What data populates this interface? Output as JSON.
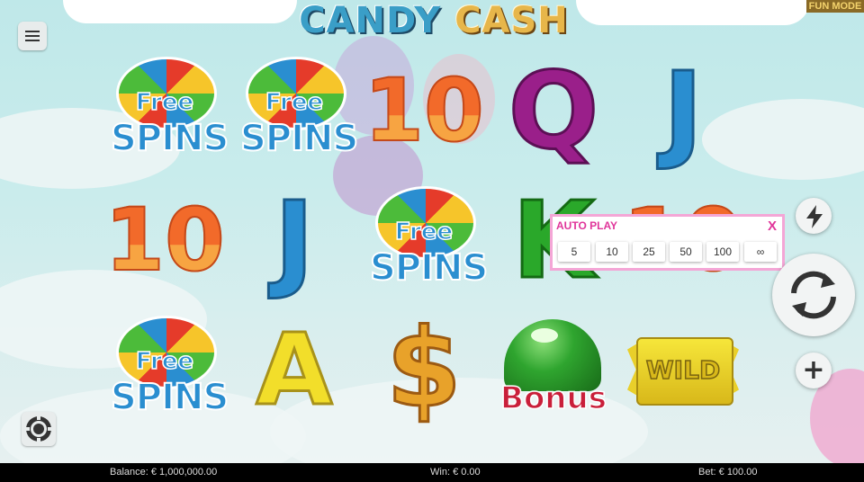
{
  "game": {
    "title_part1": "CANDY",
    "title_part2": "CASH",
    "mode_badge": "FUN MODE"
  },
  "menu": {
    "icon": "hamburger-menu-icon"
  },
  "reels": {
    "rows": [
      [
        {
          "type": "free-spins",
          "line1": "Free",
          "line2": "SPINS"
        },
        {
          "type": "free-spins",
          "line1": "Free",
          "line2": "SPINS"
        },
        {
          "type": "ten",
          "text": "10"
        },
        {
          "type": "q",
          "text": "Q"
        },
        {
          "type": "j",
          "text": "J"
        }
      ],
      [
        {
          "type": "ten",
          "text": "10"
        },
        {
          "type": "j",
          "text": "J"
        },
        {
          "type": "free-spins",
          "line1": "Free",
          "line2": "SPINS"
        },
        {
          "type": "k",
          "text": "K"
        },
        {
          "type": "ten",
          "text": "10"
        }
      ],
      [
        {
          "type": "free-spins",
          "line1": "Free",
          "line2": "SPINS"
        },
        {
          "type": "a",
          "text": "A"
        },
        {
          "type": "dollar",
          "text": "$"
        },
        {
          "type": "bonus",
          "text": "Bonus"
        },
        {
          "type": "wild",
          "text": "WILD"
        }
      ]
    ]
  },
  "auto_play": {
    "title": "AUTO PLAY",
    "close_label": "X",
    "options": [
      "5",
      "10",
      "25",
      "50",
      "100",
      "∞"
    ]
  },
  "controls": {
    "turbo_icon": "lightning-bolt-icon",
    "spin_icon": "refresh-spin-icon",
    "bet_icon": "plus-icon",
    "plus_label": "+",
    "settings_icon": "poker-chip-icon"
  },
  "status": {
    "balance_label": "Balance:",
    "balance_value": "€ 1,000,000.00",
    "win_label": "Win:",
    "win_value": "€ 0.00",
    "bet_label": "Bet:",
    "bet_value": "€ 100.00"
  },
  "colors": {
    "accent_pink": "#e0359a",
    "panel_border": "#f4a6d6",
    "status_bar": "#000000"
  }
}
